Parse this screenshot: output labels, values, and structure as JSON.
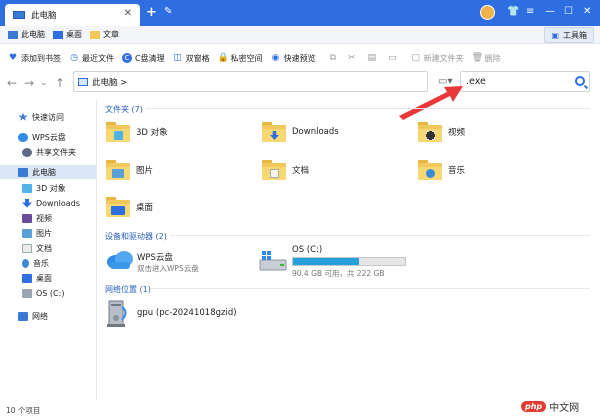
{
  "titlebar": {
    "tab_label": "此电脑"
  },
  "toolbar": {
    "crumbs": [
      "此电脑",
      "桌面",
      "文章"
    ],
    "tools_label": "工具箱"
  },
  "actions": [
    {
      "label": "添加到书签",
      "icon": "bookmark-icon"
    },
    {
      "label": "最近文件",
      "icon": "clock-icon"
    },
    {
      "label": "C盘清理",
      "icon": "clean-icon"
    },
    {
      "label": "双窗格",
      "icon": "split-pane-icon"
    },
    {
      "label": "私密空间",
      "icon": "lock-icon"
    },
    {
      "label": "快速预览",
      "icon": "eye-icon"
    }
  ],
  "actions_right": [
    {
      "label": "新建文件夹",
      "icon": "new-folder-icon"
    },
    {
      "label": "删除",
      "icon": "delete-icon"
    }
  ],
  "address": {
    "path": "此电脑 >"
  },
  "search": {
    "value": ".exe"
  },
  "sidebar": {
    "items": [
      {
        "label": "快速访问",
        "icon": "star-icon"
      },
      {
        "label": "WPS云盘",
        "icon": "wps-cloud-icon"
      },
      {
        "label": "共享文件夹",
        "icon": "shared-folder-icon"
      },
      {
        "label": "此电脑",
        "icon": "computer-icon"
      },
      {
        "label": "3D 对象",
        "icon": "3d-objects-icon"
      },
      {
        "label": "Downloads",
        "icon": "download-icon"
      },
      {
        "label": "视频",
        "icon": "video-icon"
      },
      {
        "label": "图片",
        "icon": "picture-icon"
      },
      {
        "label": "文档",
        "icon": "document-icon"
      },
      {
        "label": "音乐",
        "icon": "music-icon"
      },
      {
        "label": "桌面",
        "icon": "desktop-icon"
      },
      {
        "label": "OS (C:)",
        "icon": "drive-icon"
      },
      {
        "label": "网络",
        "icon": "network-icon"
      }
    ]
  },
  "main": {
    "folders_header": "文件夹 (7)",
    "folders": [
      {
        "label": "3D 对象",
        "icon": "3d-objects-icon"
      },
      {
        "label": "Downloads",
        "icon": "download-icon"
      },
      {
        "label": "视频",
        "icon": "video-icon"
      },
      {
        "label": "图片",
        "icon": "picture-icon"
      },
      {
        "label": "文档",
        "icon": "document-icon"
      },
      {
        "label": "音乐",
        "icon": "music-icon"
      },
      {
        "label": "桌面",
        "icon": "desktop-icon"
      }
    ],
    "devices_header": "设备和驱动器 (2)",
    "wps": {
      "name": "WPS云盘",
      "sub": "双击进入WPS云盘"
    },
    "drive": {
      "name": "OS (C:)",
      "sub": "90.4 GB 可用，共 222 GB",
      "used_fraction": 0.593
    },
    "network_header": "网络位置 (1)",
    "network_item": {
      "name": "gpu (pc-20241018gzid)"
    }
  },
  "status": {
    "count": "10 个项目"
  },
  "watermark": {
    "php": "php",
    "site": "中文网"
  },
  "colors": {
    "accent": "#2f6ee0",
    "arrow": "#e8383a",
    "drive_fill": "#26a0da"
  }
}
